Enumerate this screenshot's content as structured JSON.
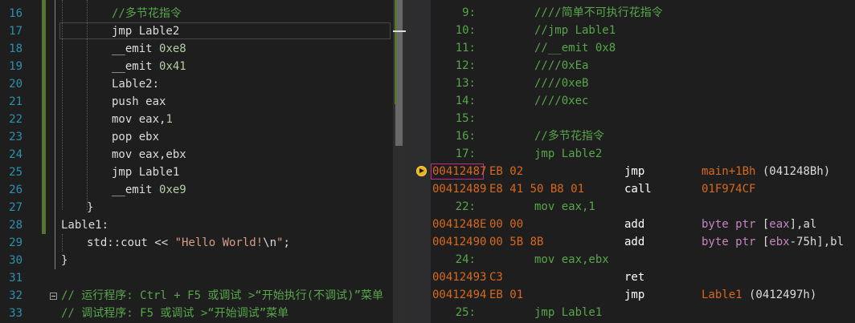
{
  "source": {
    "lines": [
      {
        "n": "16",
        "segs": [
          {
            "t": "//多节花指令",
            "c": "cmt"
          }
        ]
      },
      {
        "n": "17",
        "segs": [
          {
            "t": "jmp Lable2",
            "c": "kw"
          }
        ]
      },
      {
        "n": "18",
        "segs": [
          {
            "t": "__emit ",
            "c": "kw"
          },
          {
            "t": "0xe8",
            "c": "num"
          }
        ]
      },
      {
        "n": "19",
        "segs": [
          {
            "t": "__emit ",
            "c": "kw"
          },
          {
            "t": "0x41",
            "c": "num"
          }
        ]
      },
      {
        "n": "20",
        "segs": [
          {
            "t": "Lable2:",
            "c": "kw"
          }
        ]
      },
      {
        "n": "21",
        "segs": [
          {
            "t": "push eax",
            "c": "kw"
          }
        ]
      },
      {
        "n": "22",
        "segs": [
          {
            "t": "mov eax,",
            "c": "kw"
          },
          {
            "t": "1",
            "c": "num"
          }
        ]
      },
      {
        "n": "23",
        "segs": [
          {
            "t": "pop ebx",
            "c": "kw"
          }
        ]
      },
      {
        "n": "24",
        "segs": [
          {
            "t": "mov eax,ebx",
            "c": "kw"
          }
        ]
      },
      {
        "n": "25",
        "segs": [
          {
            "t": "jmp Lable1",
            "c": "kw"
          }
        ]
      },
      {
        "n": "26",
        "segs": [
          {
            "t": "__emit ",
            "c": "kw"
          },
          {
            "t": "0xe9",
            "c": "num"
          }
        ]
      },
      {
        "n": "27",
        "segs": [
          {
            "t": "}",
            "c": "kw"
          }
        ]
      },
      {
        "n": "28",
        "segs": [
          {
            "t": "Lable1:",
            "c": "kw"
          }
        ]
      },
      {
        "n": "29",
        "segs": [
          {
            "t": "std::cout << ",
            "c": "kw"
          },
          {
            "t": "\"Hello World!",
            "c": "str"
          },
          {
            "t": "\\n",
            "c": "kw"
          },
          {
            "t": "\"",
            "c": "str"
          },
          {
            "t": ";",
            "c": "kw"
          }
        ]
      },
      {
        "n": "30",
        "segs": [
          {
            "t": "}",
            "c": "kw"
          }
        ]
      },
      {
        "n": "31",
        "segs": []
      },
      {
        "n": "32",
        "segs": [
          {
            "t": "// 运行程序: Ctrl + F5 或调试 >“开始执行(不调试)”菜单",
            "c": "cmt"
          }
        ]
      },
      {
        "n": "33",
        "segs": [
          {
            "t": "// 调试程序: F5 或调试 >“开始调试”菜单",
            "c": "cmt"
          }
        ]
      }
    ]
  },
  "disassembly": {
    "rows": [
      {
        "kind": "src",
        "ln": "9:",
        "text": "////简单不可执行花指令"
      },
      {
        "kind": "src",
        "ln": "10:",
        "text": "//jmp Lable1"
      },
      {
        "kind": "src",
        "ln": "11:",
        "text": "//__emit 0x8"
      },
      {
        "kind": "src",
        "ln": "12:",
        "text": "////0xEa"
      },
      {
        "kind": "src",
        "ln": "13:",
        "text": "////0xeB"
      },
      {
        "kind": "src",
        "ln": "14:",
        "text": "////0xec"
      },
      {
        "kind": "src",
        "ln": "15:",
        "text": ""
      },
      {
        "kind": "src",
        "ln": "16:",
        "text": "//多节花指令"
      },
      {
        "kind": "src",
        "ln": "17:",
        "text": "jmp Lable2"
      },
      {
        "kind": "asm",
        "addr": "00412487",
        "bytes": "EB 02",
        "op": "jmp",
        "operand": [
          {
            "t": "main+1Bh",
            "c": "sym"
          },
          {
            "t": " (041248Bh)",
            "c": "plain"
          }
        ],
        "current": true
      },
      {
        "kind": "asm",
        "addr": "00412489",
        "bytes": "E8 41 50 B8 01",
        "op": "call",
        "operand": [
          {
            "t": "01F974CF",
            "c": "sym"
          }
        ]
      },
      {
        "kind": "src",
        "ln": "22:",
        "text": "mov eax,1"
      },
      {
        "kind": "asm",
        "addr": "0041248E",
        "bytes": "00 00",
        "op": "add",
        "operand": [
          {
            "t": "byte ptr ",
            "c": "kwp"
          },
          {
            "t": "[",
            "c": "plain"
          },
          {
            "t": "eax",
            "c": "kwp"
          },
          {
            "t": "],al",
            "c": "plain"
          }
        ]
      },
      {
        "kind": "asm",
        "addr": "00412490",
        "bytes": "00 5B 8B",
        "op": "add",
        "operand": [
          {
            "t": "byte ptr ",
            "c": "kwp"
          },
          {
            "t": "[",
            "c": "plain"
          },
          {
            "t": "ebx",
            "c": "kwp"
          },
          {
            "t": "-75h],bl",
            "c": "plain"
          }
        ]
      },
      {
        "kind": "src",
        "ln": "24:",
        "text": "mov eax,ebx"
      },
      {
        "kind": "asm",
        "addr": "00412493",
        "bytes": "C3",
        "op": "ret",
        "operand": []
      },
      {
        "kind": "asm",
        "addr": "00412494",
        "bytes": "EB 01",
        "op": "jmp",
        "operand": [
          {
            "t": "Lable1",
            "c": "sym"
          },
          {
            "t": " (0412497h)",
            "c": "plain"
          }
        ]
      },
      {
        "kind": "src",
        "ln": "25:",
        "text": "jmp Lable1"
      }
    ]
  },
  "icons": {
    "instruction_pointer": "instruction-pointer-arrow-icon",
    "fold": "collapse-minus-icon"
  },
  "colors": {
    "comment": "#57a64a",
    "number": "#b5cea8",
    "string": "#d69d85",
    "address": "#d7691d",
    "keyword_ptr": "#c586c0",
    "line_number": "#2b91af"
  }
}
